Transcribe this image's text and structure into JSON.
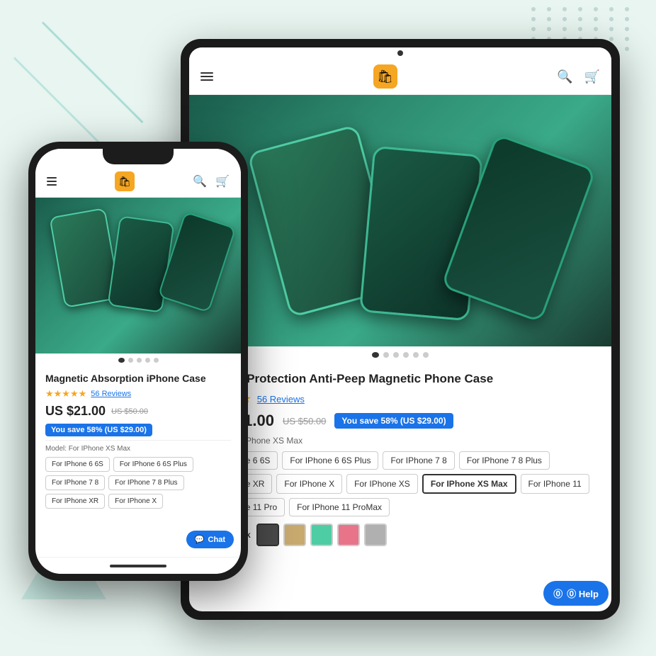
{
  "background": {
    "color": "#e8f5f0"
  },
  "tablet": {
    "header": {
      "menu_icon": "☰",
      "logo_icon": "🛍",
      "search_icon": "🔍",
      "cart_icon": "🛒"
    },
    "product": {
      "title": "Privacy Protection Anti-Peep Magnetic Phone Case",
      "stars": "★★★★★",
      "reviews_count": "56 Reviews",
      "price": "US $21.00",
      "original_price": "US $50.00",
      "savings": "You save 58% (US $29.00)",
      "model_label": "Model: For IPhone XS Max",
      "models": [
        {
          "label": "For IPhone 6 6S",
          "selected": false
        },
        {
          "label": "For IPhone 6 6S Plus",
          "selected": false
        },
        {
          "label": "For IPhone 7 8",
          "selected": false
        },
        {
          "label": "For IPhone 7 8 Plus",
          "selected": false
        },
        {
          "label": "For IPhone XR",
          "selected": false
        },
        {
          "label": "For IPhone X",
          "selected": false
        },
        {
          "label": "For IPhone XS",
          "selected": false
        },
        {
          "label": "For IPhone XS Max",
          "selected": true
        },
        {
          "label": "For IPhone 11",
          "selected": false
        },
        {
          "label": "For IPhone 11 Pro",
          "selected": false
        },
        {
          "label": "For IPhone 11 ProMax",
          "selected": false
        }
      ],
      "color_label": "Color: Black",
      "colors": [
        {
          "name": "black",
          "hex": "#4a4a4a"
        },
        {
          "name": "gold",
          "hex": "#c8a96e"
        },
        {
          "name": "teal",
          "hex": "#4ecda4"
        },
        {
          "name": "pink",
          "hex": "#e8748a"
        },
        {
          "name": "silver",
          "hex": "#b0b0b0"
        }
      ]
    },
    "image_dots": [
      {
        "active": true
      },
      {
        "active": false
      },
      {
        "active": false
      },
      {
        "active": false
      },
      {
        "active": false
      },
      {
        "active": false
      }
    ],
    "help_btn": "⓪ Help"
  },
  "phone": {
    "header": {
      "menu_icon": "☰",
      "logo_icon": "🛍",
      "search_icon": "🔍",
      "cart_icon": "🛒"
    },
    "product": {
      "title": "Magnetic Absorption iPhone Case",
      "stars": "★★★★★",
      "reviews_count": "56 Reviews",
      "price": "US $21.00",
      "original_price": "US $50.00",
      "savings": "You save 58% (US $29.00)",
      "model_label": "Model: For IPhone XS Max",
      "models": [
        {
          "label": "For IPhone 6 6S",
          "selected": false
        },
        {
          "label": "For IPhone 6 6S Plus",
          "selected": false
        },
        {
          "label": "For IPhone 7 8",
          "selected": false
        },
        {
          "label": "For IPhone 7 8 Plus",
          "selected": false
        },
        {
          "label": "For IPhone XR",
          "selected": false
        },
        {
          "label": "For IPhone X",
          "selected": false
        }
      ]
    },
    "image_dots": [
      {
        "active": true
      },
      {
        "active": false
      },
      {
        "active": false
      },
      {
        "active": false
      },
      {
        "active": false
      }
    ],
    "chat_btn": "💬 Chat"
  }
}
